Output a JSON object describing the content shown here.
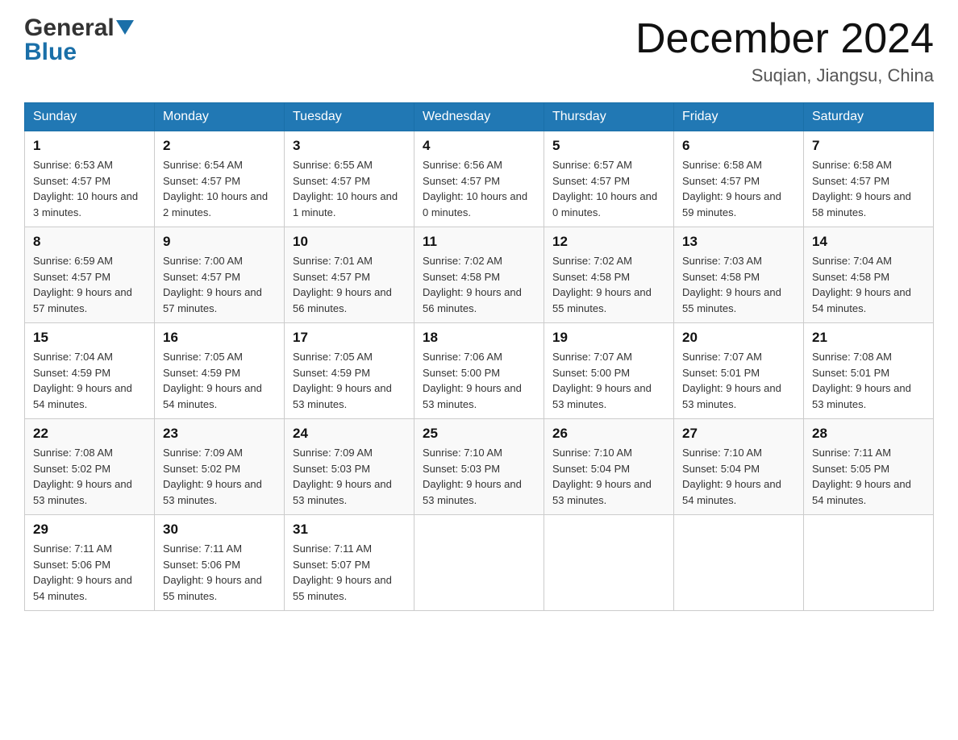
{
  "logo": {
    "general": "General",
    "blue": "Blue",
    "line1": "General",
    "line2": "Blue"
  },
  "title": "December 2024",
  "location": "Suqian, Jiangsu, China",
  "days_of_week": [
    "Sunday",
    "Monday",
    "Tuesday",
    "Wednesday",
    "Thursday",
    "Friday",
    "Saturday"
  ],
  "weeks": [
    [
      {
        "day": "1",
        "sunrise": "6:53 AM",
        "sunset": "4:57 PM",
        "daylight": "10 hours and 3 minutes."
      },
      {
        "day": "2",
        "sunrise": "6:54 AM",
        "sunset": "4:57 PM",
        "daylight": "10 hours and 2 minutes."
      },
      {
        "day": "3",
        "sunrise": "6:55 AM",
        "sunset": "4:57 PM",
        "daylight": "10 hours and 1 minute."
      },
      {
        "day": "4",
        "sunrise": "6:56 AM",
        "sunset": "4:57 PM",
        "daylight": "10 hours and 0 minutes."
      },
      {
        "day": "5",
        "sunrise": "6:57 AM",
        "sunset": "4:57 PM",
        "daylight": "10 hours and 0 minutes."
      },
      {
        "day": "6",
        "sunrise": "6:58 AM",
        "sunset": "4:57 PM",
        "daylight": "9 hours and 59 minutes."
      },
      {
        "day": "7",
        "sunrise": "6:58 AM",
        "sunset": "4:57 PM",
        "daylight": "9 hours and 58 minutes."
      }
    ],
    [
      {
        "day": "8",
        "sunrise": "6:59 AM",
        "sunset": "4:57 PM",
        "daylight": "9 hours and 57 minutes."
      },
      {
        "day": "9",
        "sunrise": "7:00 AM",
        "sunset": "4:57 PM",
        "daylight": "9 hours and 57 minutes."
      },
      {
        "day": "10",
        "sunrise": "7:01 AM",
        "sunset": "4:57 PM",
        "daylight": "9 hours and 56 minutes."
      },
      {
        "day": "11",
        "sunrise": "7:02 AM",
        "sunset": "4:58 PM",
        "daylight": "9 hours and 56 minutes."
      },
      {
        "day": "12",
        "sunrise": "7:02 AM",
        "sunset": "4:58 PM",
        "daylight": "9 hours and 55 minutes."
      },
      {
        "day": "13",
        "sunrise": "7:03 AM",
        "sunset": "4:58 PM",
        "daylight": "9 hours and 55 minutes."
      },
      {
        "day": "14",
        "sunrise": "7:04 AM",
        "sunset": "4:58 PM",
        "daylight": "9 hours and 54 minutes."
      }
    ],
    [
      {
        "day": "15",
        "sunrise": "7:04 AM",
        "sunset": "4:59 PM",
        "daylight": "9 hours and 54 minutes."
      },
      {
        "day": "16",
        "sunrise": "7:05 AM",
        "sunset": "4:59 PM",
        "daylight": "9 hours and 54 minutes."
      },
      {
        "day": "17",
        "sunrise": "7:05 AM",
        "sunset": "4:59 PM",
        "daylight": "9 hours and 53 minutes."
      },
      {
        "day": "18",
        "sunrise": "7:06 AM",
        "sunset": "5:00 PM",
        "daylight": "9 hours and 53 minutes."
      },
      {
        "day": "19",
        "sunrise": "7:07 AM",
        "sunset": "5:00 PM",
        "daylight": "9 hours and 53 minutes."
      },
      {
        "day": "20",
        "sunrise": "7:07 AM",
        "sunset": "5:01 PM",
        "daylight": "9 hours and 53 minutes."
      },
      {
        "day": "21",
        "sunrise": "7:08 AM",
        "sunset": "5:01 PM",
        "daylight": "9 hours and 53 minutes."
      }
    ],
    [
      {
        "day": "22",
        "sunrise": "7:08 AM",
        "sunset": "5:02 PM",
        "daylight": "9 hours and 53 minutes."
      },
      {
        "day": "23",
        "sunrise": "7:09 AM",
        "sunset": "5:02 PM",
        "daylight": "9 hours and 53 minutes."
      },
      {
        "day": "24",
        "sunrise": "7:09 AM",
        "sunset": "5:03 PM",
        "daylight": "9 hours and 53 minutes."
      },
      {
        "day": "25",
        "sunrise": "7:10 AM",
        "sunset": "5:03 PM",
        "daylight": "9 hours and 53 minutes."
      },
      {
        "day": "26",
        "sunrise": "7:10 AM",
        "sunset": "5:04 PM",
        "daylight": "9 hours and 53 minutes."
      },
      {
        "day": "27",
        "sunrise": "7:10 AM",
        "sunset": "5:04 PM",
        "daylight": "9 hours and 54 minutes."
      },
      {
        "day": "28",
        "sunrise": "7:11 AM",
        "sunset": "5:05 PM",
        "daylight": "9 hours and 54 minutes."
      }
    ],
    [
      {
        "day": "29",
        "sunrise": "7:11 AM",
        "sunset": "5:06 PM",
        "daylight": "9 hours and 54 minutes."
      },
      {
        "day": "30",
        "sunrise": "7:11 AM",
        "sunset": "5:06 PM",
        "daylight": "9 hours and 55 minutes."
      },
      {
        "day": "31",
        "sunrise": "7:11 AM",
        "sunset": "5:07 PM",
        "daylight": "9 hours and 55 minutes."
      },
      null,
      null,
      null,
      null
    ]
  ]
}
